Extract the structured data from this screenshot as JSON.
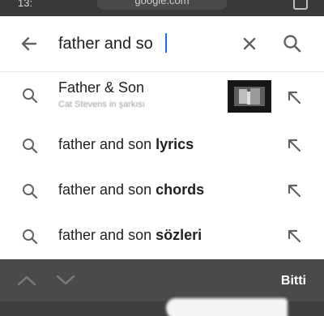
{
  "status_bar": {
    "time": "13:",
    "url": "google.com"
  },
  "search": {
    "query": "father and so"
  },
  "suggestions": [
    {
      "title": "Father & Son",
      "subtitle": "Cat Stevens in şarkısı"
    },
    {
      "prefix": "father and son",
      "suffix": "lyrics"
    },
    {
      "prefix": "father and son",
      "suffix": "chords"
    },
    {
      "prefix": "father and son",
      "suffix": "sözleri"
    }
  ],
  "keyboard_toolbar": {
    "done_label": "Bitti"
  },
  "colors": {
    "accent": "#1a73e8",
    "toolbar": "#4a4a4c",
    "icon": "#5f6368"
  }
}
